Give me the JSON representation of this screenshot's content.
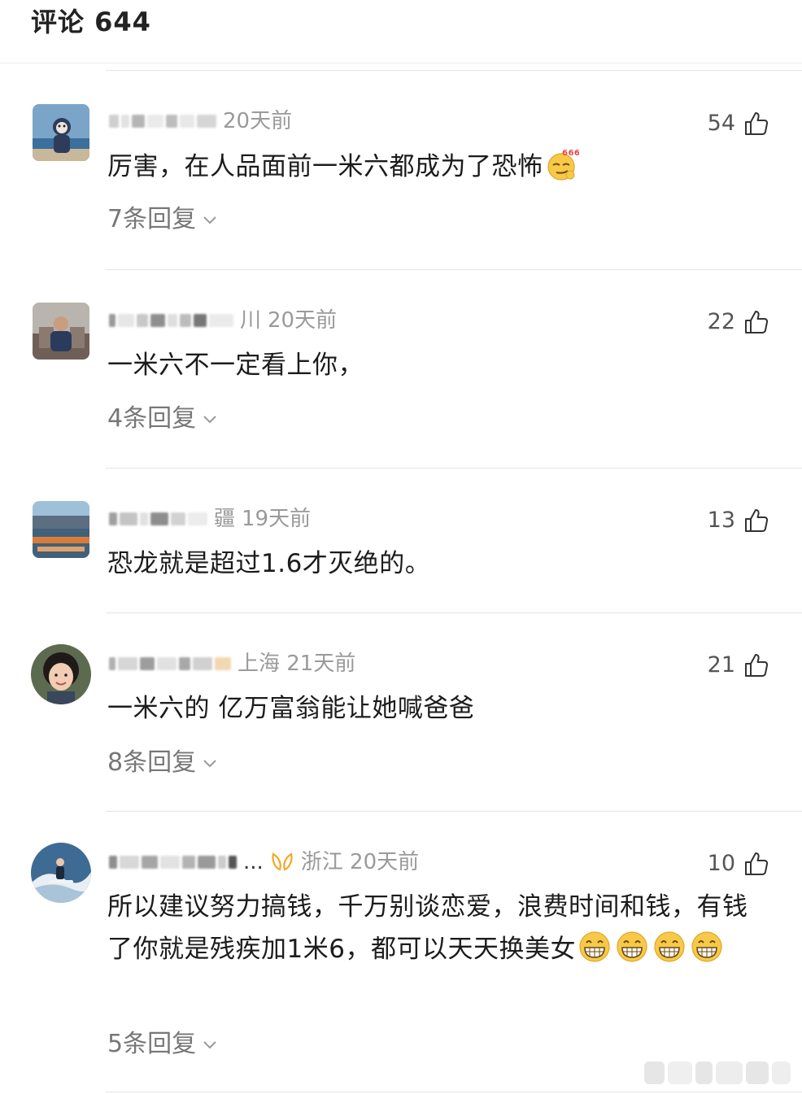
{
  "header": {
    "title": "评论 644"
  },
  "comments": [
    {
      "name_tail": "",
      "meta": "20天前",
      "likes": "54",
      "text": "厉害，在人品面前一米六都成为了恐怖",
      "emoji_badge": "666",
      "replies": "7条回复"
    },
    {
      "name_tail": "川",
      "meta": "20天前",
      "likes": "22",
      "text": "一米六不一定看上你，",
      "replies": "4条回复"
    },
    {
      "name_tail": "疆",
      "meta": "19天前",
      "likes": "13",
      "text": "恐龙就是超过1.6才灭绝的。"
    },
    {
      "name_tail": "",
      "meta": "上海  21天前",
      "likes": "21",
      "text": "一米六的 亿万富翁能让她喊爸爸",
      "replies": "8条回复"
    },
    {
      "name_tail": "...",
      "meta": "浙江  20天前",
      "likes": "10",
      "text": "所以建议努力搞钱，千万别谈恋爱，浪费时间和钱，有钱了你就是残疾加1米6，都可以天天换美女",
      "replies": "5条回复"
    }
  ],
  "icons": {
    "like": "thumbs-up-icon",
    "reply_expand": "chevron-down-icon",
    "vip": "vip-badge-icon",
    "emoji_smirk": "smirk-666-emoji",
    "emoji_grin": "grin-emoji"
  },
  "colors": {
    "text": "#1c1c1c",
    "meta": "#9a9a9a",
    "divider": "#e4e4e4",
    "vip": "#f5a623",
    "emoji": "#f7c948"
  }
}
